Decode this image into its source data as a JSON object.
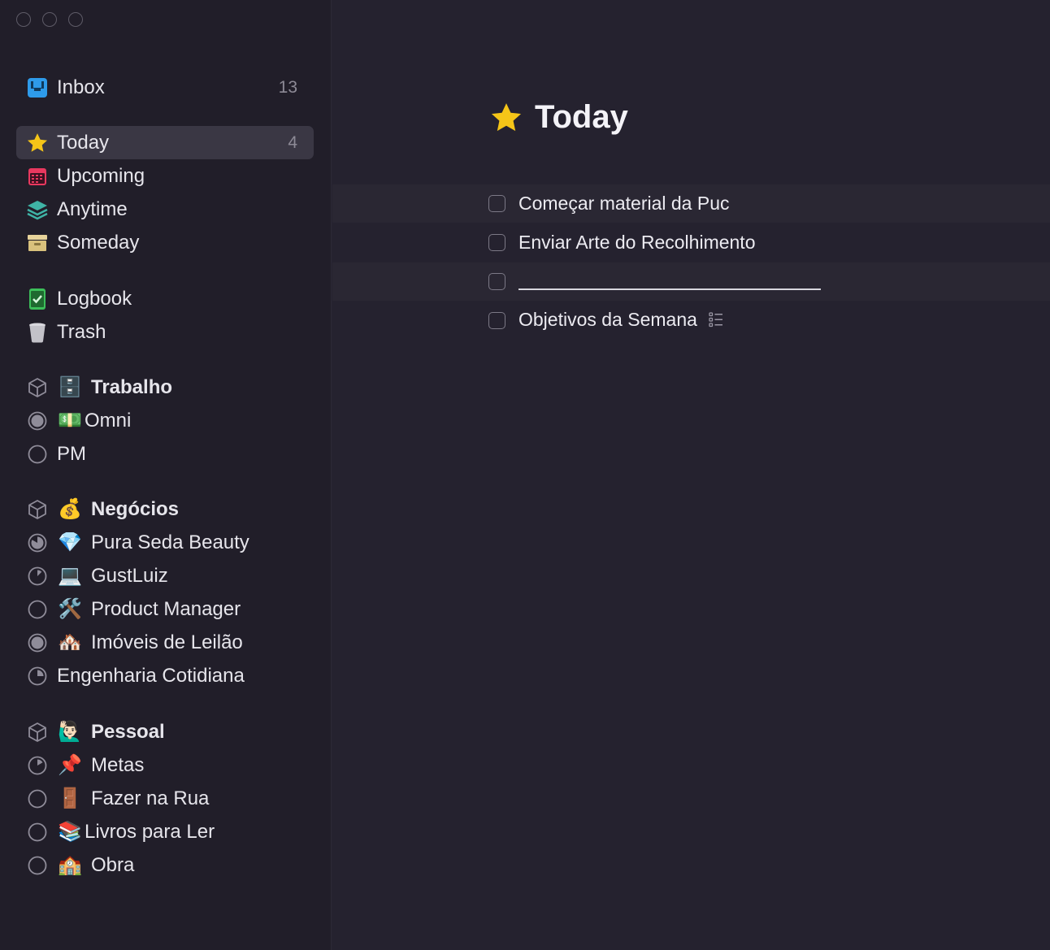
{
  "window": {
    "controls": [
      "close",
      "minimize",
      "zoom"
    ]
  },
  "sidebar": {
    "inbox": {
      "label": "Inbox",
      "count": "13",
      "icon": "inbox-tray-icon"
    },
    "lists": [
      {
        "label": "Today",
        "count": "4",
        "icon": "star-icon",
        "selected": true
      },
      {
        "label": "Upcoming",
        "icon": "calendar-icon"
      },
      {
        "label": "Anytime",
        "icon": "layers-icon"
      },
      {
        "label": "Someday",
        "icon": "archive-box-icon"
      }
    ],
    "logs": [
      {
        "label": "Logbook",
        "icon": "logbook-check-icon"
      },
      {
        "label": "Trash",
        "icon": "trash-icon"
      }
    ],
    "areas": [
      {
        "emoji": "🗄️",
        "label": "Trabalho",
        "projects": [
          {
            "emoji": "💵",
            "label": "Omni"
          },
          {
            "emoji": "",
            "label": "PM"
          }
        ]
      },
      {
        "emoji": "💰",
        "label": "Negócios",
        "projects": [
          {
            "emoji": "💎",
            "label": "Pura Seda Beauty"
          },
          {
            "emoji": "💻",
            "label": "GustLuiz"
          },
          {
            "emoji": "🛠️",
            "label": "Product Manager"
          },
          {
            "emoji": "🏘️",
            "label": "Imóveis de Leilão"
          },
          {
            "emoji": "",
            "label": "Engenharia Cotidiana"
          }
        ]
      },
      {
        "emoji": "🙋🏻‍♂️",
        "label": "Pessoal",
        "projects": [
          {
            "emoji": "📌",
            "label": "Metas"
          },
          {
            "emoji": "🚪",
            "label": "Fazer na Rua"
          },
          {
            "emoji": "📚",
            "label": "Livros para Ler"
          },
          {
            "emoji": "🏫",
            "label": "Obra"
          }
        ]
      }
    ]
  },
  "main": {
    "title": "Today",
    "title_icon": "star-icon",
    "tasks": [
      {
        "text": "Começar material da Puc",
        "has_checklist": false
      },
      {
        "text": "Enviar Arte do Recolhimento",
        "has_checklist": false
      },
      {
        "text": "",
        "has_checklist": false
      },
      {
        "text": "Objetivos da Semana",
        "has_checklist": true
      }
    ]
  },
  "colors": {
    "accent_star": "#f5c518",
    "sidebar_bg": "#211e29",
    "main_bg": "#25222f",
    "selected_bg": "#3a3744"
  }
}
